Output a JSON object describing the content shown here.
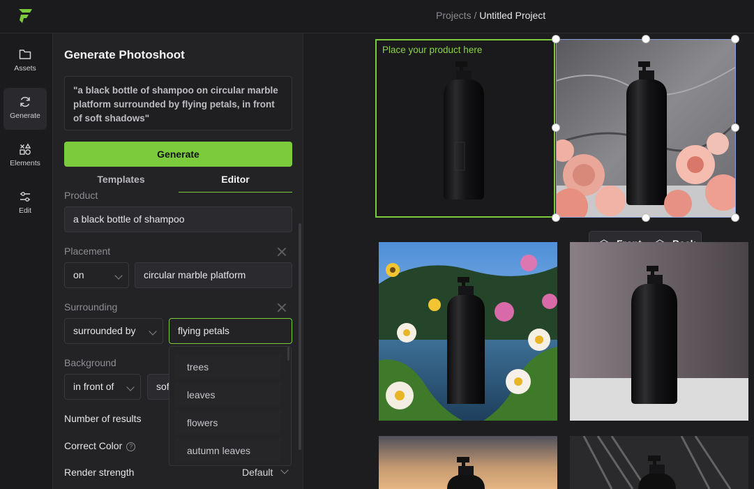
{
  "colors": {
    "accent": "#7ccb3c",
    "panel_bg": "#232326",
    "app_bg": "#1b1b1d"
  },
  "topbar": {
    "breadcrumb_root": "Projects",
    "breadcrumb_sep": " / ",
    "breadcrumb_current": "Untitled Project",
    "logo_icon": "brand-logo-icon"
  },
  "rail": {
    "items": [
      {
        "label": "Assets",
        "icon": "folder-icon"
      },
      {
        "label": "Generate",
        "icon": "refresh-icon"
      },
      {
        "label": "Elements",
        "icon": "shapes-icon"
      },
      {
        "label": "Edit",
        "icon": "sliders-icon"
      }
    ]
  },
  "panel": {
    "title": "Generate Photoshoot",
    "prompt": "\"a black bottle of shampoo on circular marble platform surrounded by flying petals, in front of soft shadows\"",
    "generate_label": "Generate",
    "tabs": [
      {
        "label": "Templates"
      },
      {
        "label": "Editor"
      }
    ],
    "product": {
      "label": "Product",
      "value": "a black bottle of shampoo"
    },
    "placement": {
      "label": "Placement",
      "preposition": "on",
      "value": "circular marble platform"
    },
    "surrounding": {
      "label": "Surrounding",
      "preposition": "surrounded by",
      "value": "flying petals"
    },
    "background": {
      "label": "Background",
      "preposition": "in front of",
      "value": "sof"
    },
    "number_of_results": {
      "label": "Number of results"
    },
    "correct_color": {
      "label": "Correct Color",
      "help": "?"
    },
    "render_strength": {
      "label": "Render strength",
      "value": "Default"
    },
    "dropdown_options": [
      "trees",
      "leaves",
      "flowers",
      "autumn leaves"
    ]
  },
  "canvas": {
    "placeholder_label": "Place your product here",
    "front_label": "Front",
    "back_label": "Back"
  }
}
